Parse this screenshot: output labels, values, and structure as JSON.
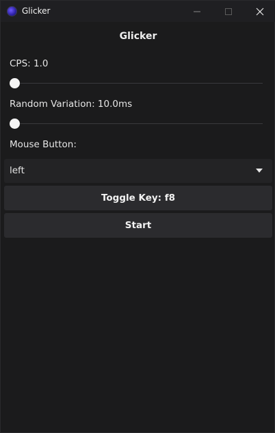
{
  "window": {
    "title": "Glicker",
    "icon": "glicker-app-icon",
    "controls": [
      "minimize-icon",
      "maximize-icon",
      "close-icon"
    ]
  },
  "main": {
    "heading": "Glicker",
    "cps": {
      "label": "CPS: 1.0",
      "slider_value_fraction": 0.0
    },
    "random_variation": {
      "label": "Random Variation: 10.0ms",
      "slider_value_fraction": 0.0
    },
    "mouse_button": {
      "label": "Mouse Button:",
      "selected": "left"
    },
    "toggle_key_button": "Toggle Key: f8",
    "start_button": "Start"
  }
}
